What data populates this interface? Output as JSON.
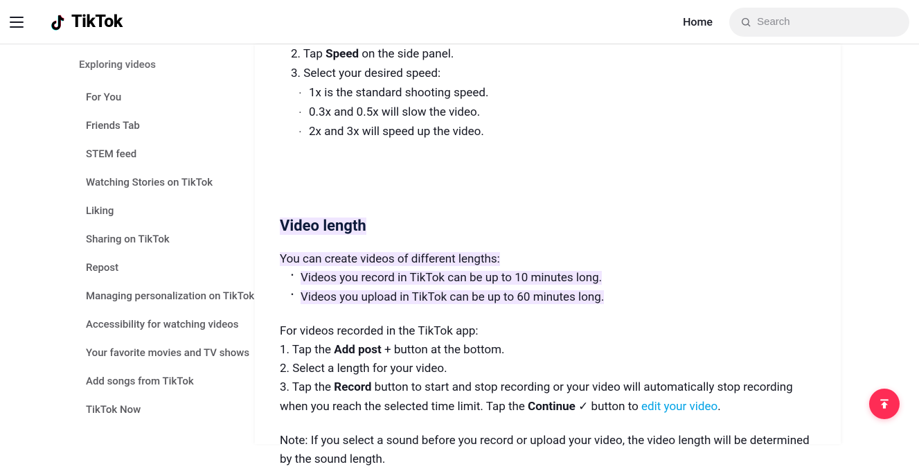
{
  "header": {
    "logo_text": "TikTok",
    "home_label": "Home",
    "search_placeholder": "Search"
  },
  "sidebar": {
    "heading": "Exploring videos",
    "items": [
      "For You",
      "Friends Tab",
      "STEM feed",
      "Watching Stories on TikTok",
      "Liking",
      "Sharing on TikTok",
      "Repost",
      "Managing personalization on TikTok",
      "Accessibility for watching videos",
      "Your favorite movies and TV shows",
      "Add songs from TikTok",
      "TikTok Now"
    ]
  },
  "content": {
    "step2_a": "2. Tap ",
    "step2_b": "Speed",
    "step2_c": " on the side panel.",
    "step3": "3. Select your desired speed:",
    "speed_sub1": "1x is the standard shooting speed.",
    "speed_sub2": "0.3x and 0.5x will slow the video.",
    "speed_sub3": "2x and 3x will speed up the video.",
    "section_title": "Video length",
    "intro": "You can create videos of different lengths:",
    "bullet1": "Videos you record in TikTok can be up to 10 minutes long.",
    "bullet2": "Videos you upload in TikTok can be up to 60 minutes long.",
    "recorded_intro": "For videos recorded in the TikTok app:",
    "rec1_a": "1. Tap the ",
    "rec1_b": "Add post",
    "rec1_c": " + button at the bottom.",
    "rec2": "2. Select a length for your video.",
    "rec3_a": "3. Tap the ",
    "rec3_b": "Record",
    "rec3_c": " button to start and stop recording or your video will automatically stop recording when you reach the selected time limit. Tap the ",
    "rec3_d": "Continue",
    "rec3_e": " ✓ button to ",
    "rec3_link": "edit your video",
    "rec3_f": ".",
    "note": "Note: If you select a sound before you record or upload your video, the video length will be determined by the sound length."
  }
}
